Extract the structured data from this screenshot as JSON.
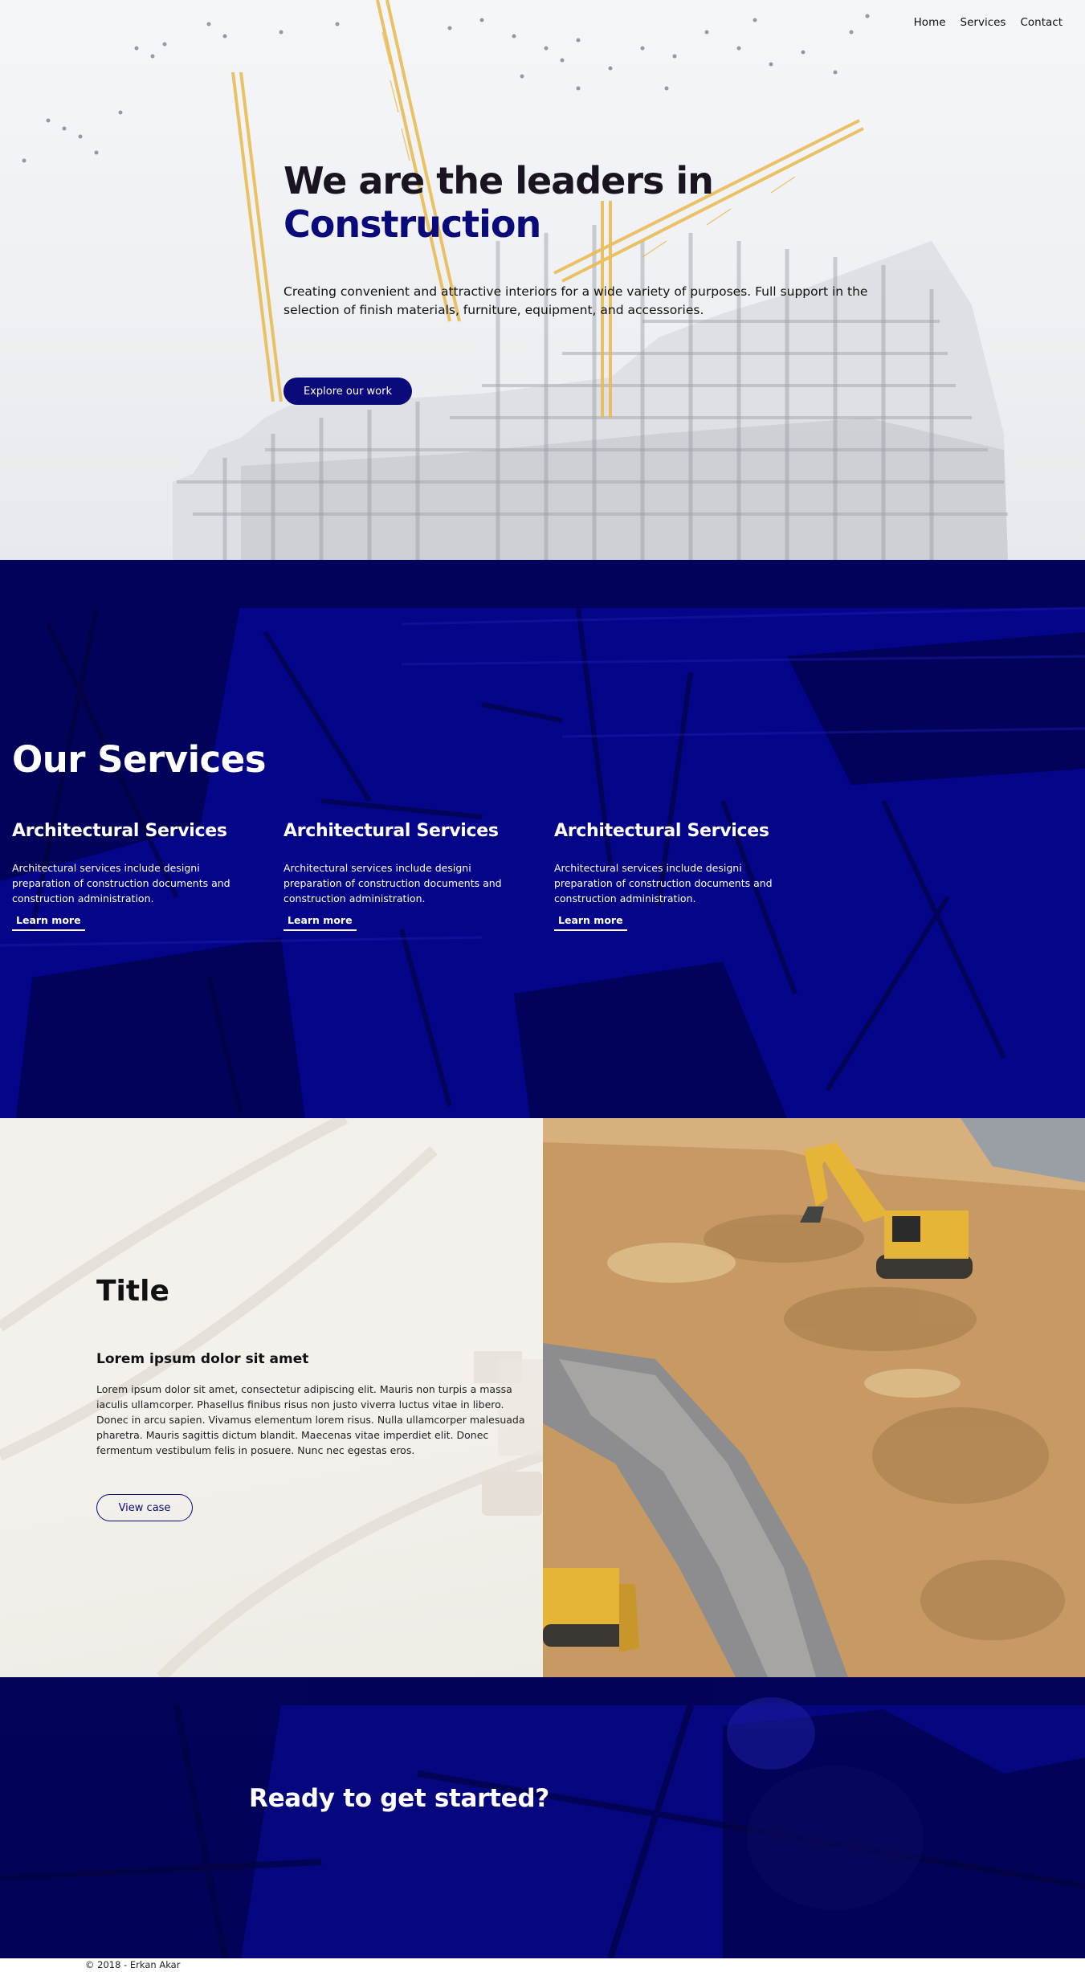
{
  "nav": {
    "items": [
      "Home",
      "Services",
      "Contact"
    ]
  },
  "hero": {
    "title_line1": "We are the leaders in",
    "title_line2": "Construction",
    "description": "Creating convenient and attractive interiors for a wide variety of purposes. Full support in the selection of finish materials, furniture, equipment, and accessories.",
    "cta_label": "Explore our work"
  },
  "services": {
    "title": "Our Services",
    "items": [
      {
        "title": "Architectural Services",
        "description": "Architectural services include designi preparation of construction documents and construction administration.",
        "link_label": "Learn more"
      },
      {
        "title": "Architectural Services",
        "description": "Architectural services include designi preparation of construction documents and construction administration.",
        "link_label": "Learn more"
      },
      {
        "title": "Architectural Services",
        "description": "Architectural services include designi preparation of construction documents and construction administration.",
        "link_label": "Learn more"
      }
    ]
  },
  "case": {
    "title": "Title",
    "subtitle": "Lorem ipsum dolor sit amet",
    "body": "Lorem ipsum dolor sit amet, consectetur adipiscing elit. Mauris non turpis a massa iaculis ullamcorper. Phasellus finibus risus non justo viverra luctus vitae in libero. Donec in arcu sapien. Vivamus elementum lorem risus. Nulla ullamcorper malesuada pharetra. Mauris sagittis dictum blandit. Maecenas vitae imperdiet elit. Donec fermentum vestibulum felis in posuere. Nunc nec egestas eros.",
    "button_label": "View case"
  },
  "cta": {
    "title": "Ready to get started?"
  },
  "footer": {
    "text": "© 2018 - Erkan Akar"
  },
  "colors": {
    "brand_navy": "#0a0a7a",
    "services_bg": "#05058a",
    "crane_yellow": "#e9b94a",
    "sand": "#c89a64"
  }
}
